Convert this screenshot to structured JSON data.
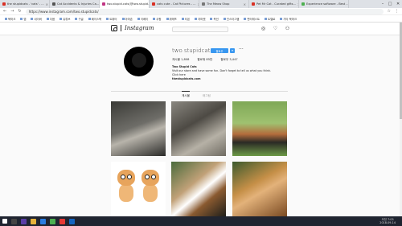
{
  "browser": {
    "tabs": [
      {
        "title": "the stupidcats - 'cats' - ...",
        "color": "#d93025"
      },
      {
        "title": "Cat Accidents & Injuries Ca...",
        "color": "#555555"
      },
      {
        "title": "two.stupid.cats(@two.stupid...",
        "color": "#c13584",
        "active": true
      },
      {
        "title": "cats cute - Cat Pictures - ...",
        "color": "#d93025"
      },
      {
        "title": "The Meow Shop",
        "color": "#777777"
      },
      {
        "title": "Pet Mr Cat - Curated gifts...",
        "color": "#d93025"
      },
      {
        "title": "Experience software - Best ...",
        "color": "#4caf50"
      }
    ],
    "url": "https://www.instagram.com/two.stupidcats/",
    "bookmarks": [
      "북마크",
      "앱",
      "네이버",
      "다음",
      "유튜브",
      "구글",
      "페이스북",
      "트위터",
      "아마존",
      "이베이",
      "쿠팡",
      "위메프",
      "티몬",
      "지마켓",
      "옥션",
      "인스타그램",
      "핀터레스트",
      "트렐로",
      "기타 북마크"
    ]
  },
  "instagram": {
    "brand": "Instagram",
    "profile": {
      "username": "two.stupidcats",
      "follow_label": "팔로우",
      "more": "···",
      "posts": "게시물 1,808",
      "followers": "팔로워 85만",
      "following": "팔로우 3,447",
      "full_name": "Two Stupid Cats",
      "bio_line": "Visit our store and have some fun. Don't forget to tell us what you think.",
      "bio_line2": "Click here",
      "website": "thestupidcats.com"
    },
    "tabs": [
      "게시물",
      "태그됨"
    ]
  },
  "taskbar": {
    "time": "오전 7:05",
    "date": "2018-09-14"
  }
}
